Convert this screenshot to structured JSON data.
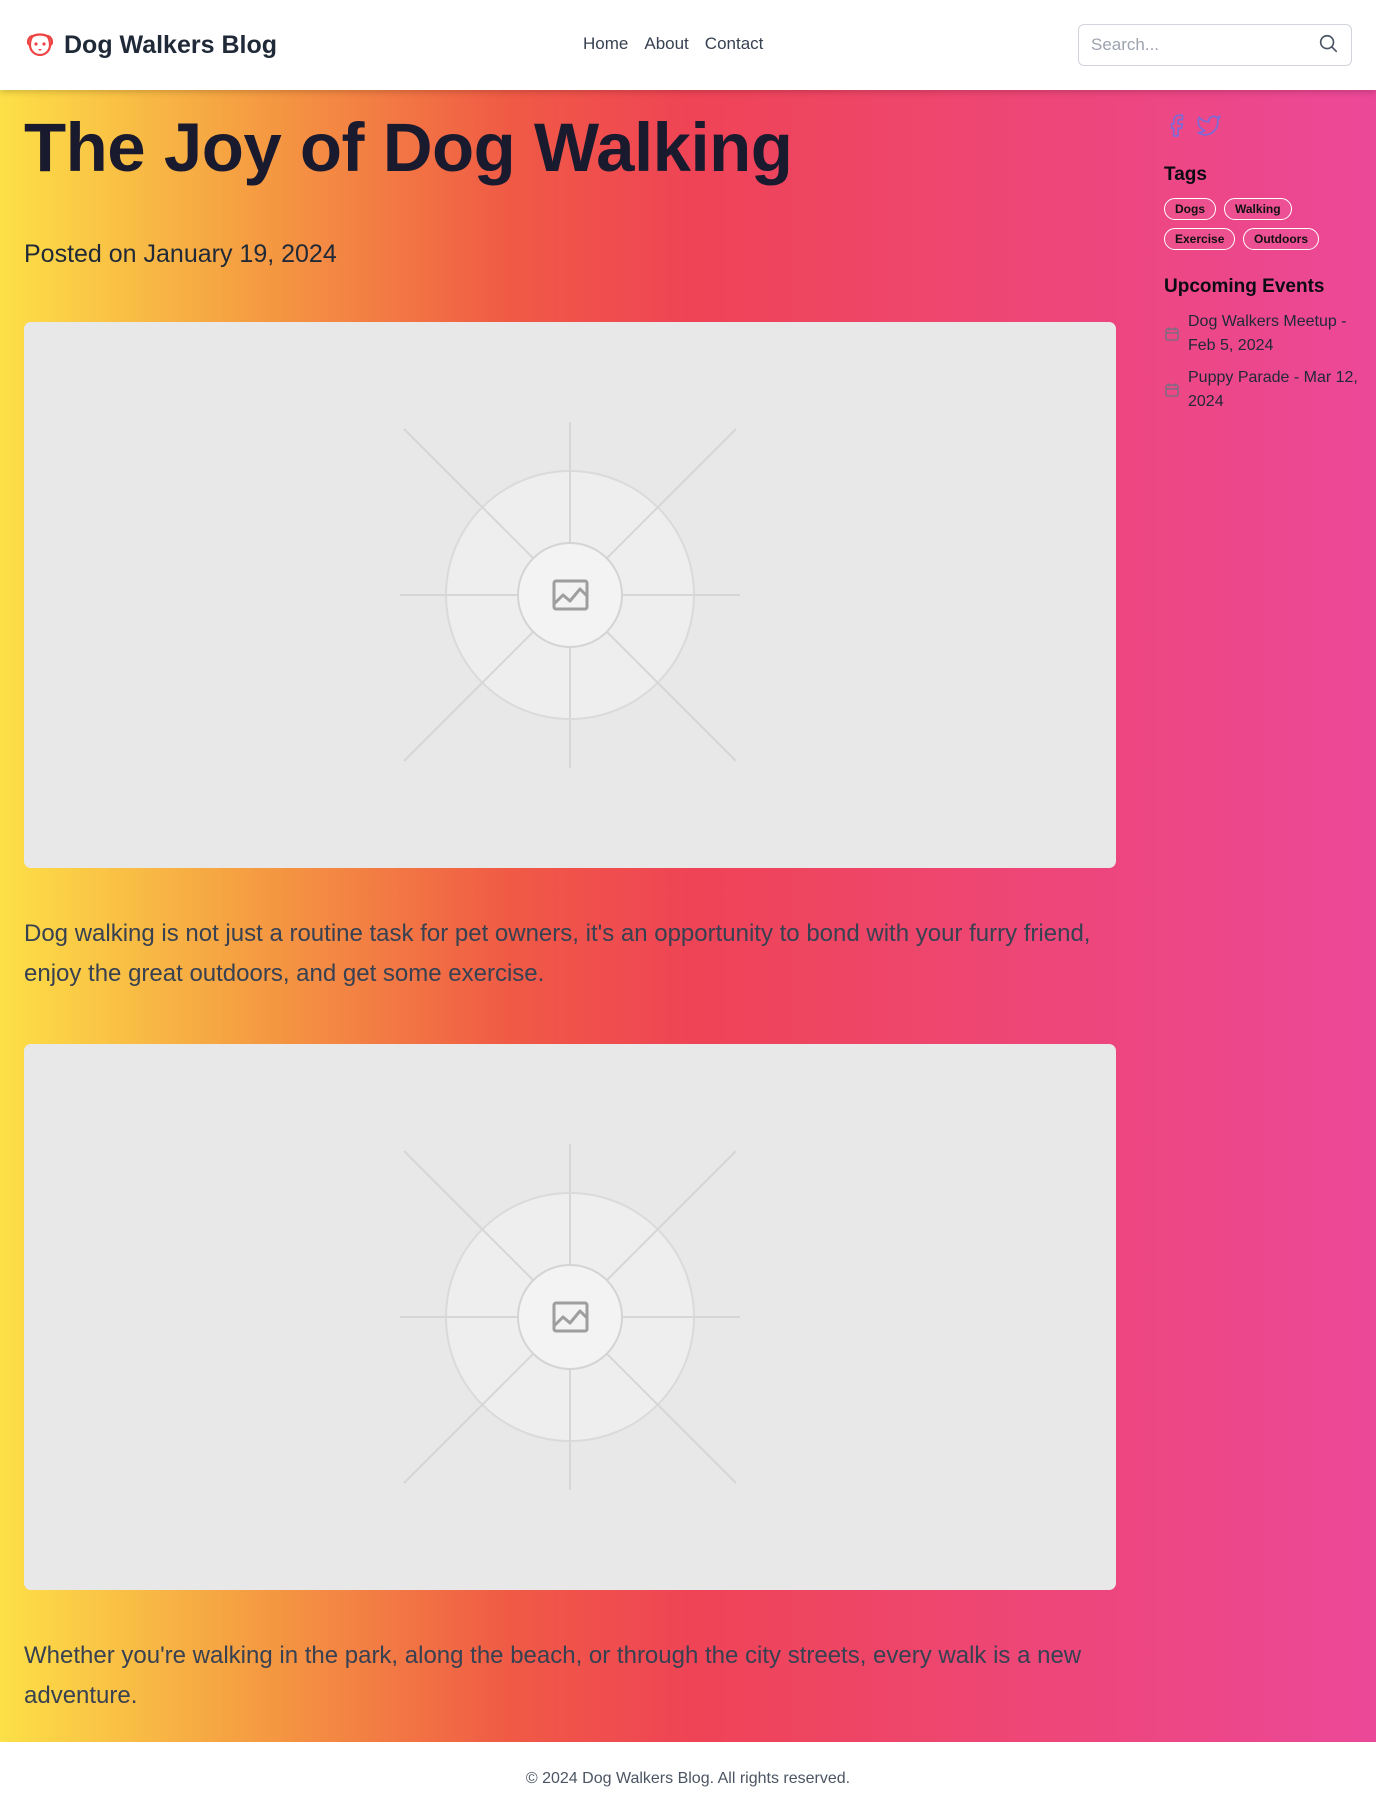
{
  "header": {
    "brand_title": "Dog Walkers Blog",
    "brand_icon": "dog-icon",
    "nav": [
      {
        "label": "Home"
      },
      {
        "label": "About"
      },
      {
        "label": "Contact"
      }
    ],
    "search": {
      "placeholder": "Search...",
      "value": "",
      "icon": "search-icon"
    }
  },
  "article": {
    "title": "The Joy of Dog Walking",
    "date": "Posted on January 19, 2024",
    "images": [
      {
        "alt": "image-placeholder",
        "icon": "image-icon"
      },
      {
        "alt": "image-placeholder",
        "icon": "image-icon"
      }
    ],
    "paragraphs": [
      "Dog walking is not just a routine task for pet owners, it's an opportunity to bond with your furry friend, enjoy the great outdoors, and get some exercise.",
      "Whether you're walking in the park, along the beach, or through the city streets, every walk is a new adventure."
    ]
  },
  "sidebar": {
    "social": [
      {
        "name": "facebook-icon"
      },
      {
        "name": "twitter-icon"
      }
    ],
    "tags_heading": "Tags",
    "tags": [
      "Dogs",
      "Walking",
      "Exercise",
      "Outdoors"
    ],
    "events_heading": "Upcoming Events",
    "events": [
      {
        "icon": "calendar-icon",
        "text": "Dog Walkers Meetup - Feb 5, 2024"
      },
      {
        "icon": "calendar-icon",
        "text": "Puppy Parade - Mar 12, 2024"
      }
    ]
  },
  "footer": {
    "copyright": "© 2024 Dog Walkers Blog. All rights reserved."
  },
  "colors": {
    "gradient_start": "#fde047",
    "gradient_mid": "#ef4455",
    "gradient_end": "#ec4899",
    "social_icon": "#7c6bd6",
    "brand_icon": "#ef4444"
  }
}
